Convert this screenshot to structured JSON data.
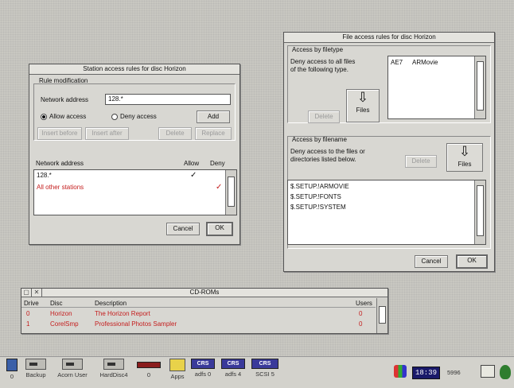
{
  "station_window": {
    "title": "Station access rules for disc Horizon",
    "rule_group_label": "Rule modification",
    "network_address_label": "Network address",
    "network_address_value": "128.*",
    "allow_label": "Allow access",
    "deny_label": "Deny access",
    "add_label": "Add",
    "insert_before_label": "Insert before",
    "insert_after_label": "Insert after",
    "delete_label": "Delete",
    "replace_label": "Replace",
    "col_address": "Network address",
    "col_allow": "Allow",
    "col_deny": "Deny",
    "rows": [
      {
        "address": "128.*",
        "allow": "✓",
        "deny": ""
      },
      {
        "address": "All other stations",
        "allow": "",
        "deny": "✓"
      }
    ],
    "cancel_label": "Cancel",
    "ok_label": "OK"
  },
  "file_window": {
    "title": "File access rules for disc Horizon",
    "filetype_group_label": "Access by filetype",
    "filetype_desc_1": "Deny access to all files",
    "filetype_desc_2": "of the following type.",
    "filetype_entry_code": "AE7",
    "filetype_entry_name": "ARMovie",
    "delete_label": "Delete",
    "files_label": "Files",
    "filename_group_label": "Access by filename",
    "filename_desc_1": "Deny access to the files or",
    "filename_desc_2": "directories listed below.",
    "filename_delete_label": "Delete",
    "filename_files_label": "Files",
    "filenames": [
      "$.SETUP.!ARMOVIE",
      "$.SETUP.!FONTS",
      "$.SETUP.!SYSTEM"
    ],
    "cancel_label": "Cancel",
    "ok_label": "OK"
  },
  "cdroms_window": {
    "title": "CD-ROMs",
    "col_drive": "Drive",
    "col_disc": "Disc",
    "col_description": "Description",
    "col_users": "Users",
    "rows": [
      {
        "drive": "0",
        "disc": "Horizon",
        "description": "The Horizon Report",
        "users": "0"
      },
      {
        "drive": "1",
        "disc": "CorelSmp",
        "description": "Professional Photos Sampler",
        "users": "0"
      }
    ]
  },
  "iconbar": {
    "items": [
      "0",
      "Backup",
      "Acorn User",
      "HardDisc4",
      "0",
      "Apps",
      "adfs 0",
      "adfs 4",
      "SCSI 5"
    ],
    "crs_label": "CRS",
    "clock": "18:39",
    "free_mem": "5996"
  }
}
